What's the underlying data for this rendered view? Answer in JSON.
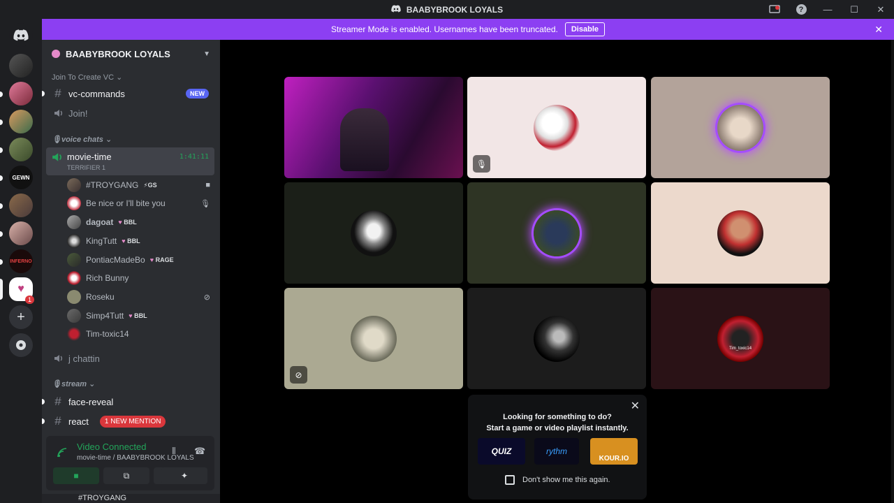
{
  "window": {
    "title": "BAABYBROOK LOYALS"
  },
  "banner": {
    "text": "Streamer Mode is enabled. Usernames have been truncated.",
    "button": "Disable"
  },
  "guild": {
    "name": "BAABYBROOK LOYALS"
  },
  "channels": {
    "join_category": "Join To Create VC",
    "vc_commands": "vc-commands",
    "new_badge": "NEW",
    "join": "Join!",
    "voice_category": "voice chats",
    "movie_time": "movie-time",
    "movie_sub": "TERRIFIER 1",
    "timer": "1:41:11",
    "j_chattin": "j chattin",
    "stream_category": "stream",
    "face_reveal": "face-reveal",
    "react": "react",
    "mention_badge": "1 NEW MENTION"
  },
  "voice_users": [
    {
      "name": "#TROYGANG",
      "tag": "⚡GS"
    },
    {
      "name": "Be nice or I'll bite you",
      "tag": ""
    },
    {
      "name": "dagoat",
      "tag": "BBL"
    },
    {
      "name": "KingTutt",
      "tag": "BBL"
    },
    {
      "name": "PontiacMadeBo",
      "tag": "RAGE"
    },
    {
      "name": "Rich Bunny",
      "tag": ""
    },
    {
      "name": "Roseku",
      "tag": ""
    },
    {
      "name": "Simp4Tutt",
      "tag": "BBL"
    },
    {
      "name": "Tim-toxic14",
      "tag": ""
    }
  ],
  "voice_panel": {
    "status": "Video Connected",
    "sub": "movie-time / BAABYBROOK LOYALS",
    "user_strip": "#TROYGANG"
  },
  "rail": {
    "badge": "1"
  },
  "popup": {
    "line1": "Looking for something to do?",
    "line2": "Start a game or video playlist instantly.",
    "act1": "QUIZ",
    "act2": "rythm",
    "act3": "KOUR.IO",
    "checkbox_label": "Don't show me this again."
  },
  "tile_labels": {
    "tim": "Tim_toxic14"
  },
  "colors": {
    "accent": "#8c3ff2",
    "online": "#23a55a",
    "mention": "#da373c",
    "brand": "#5865f2"
  }
}
